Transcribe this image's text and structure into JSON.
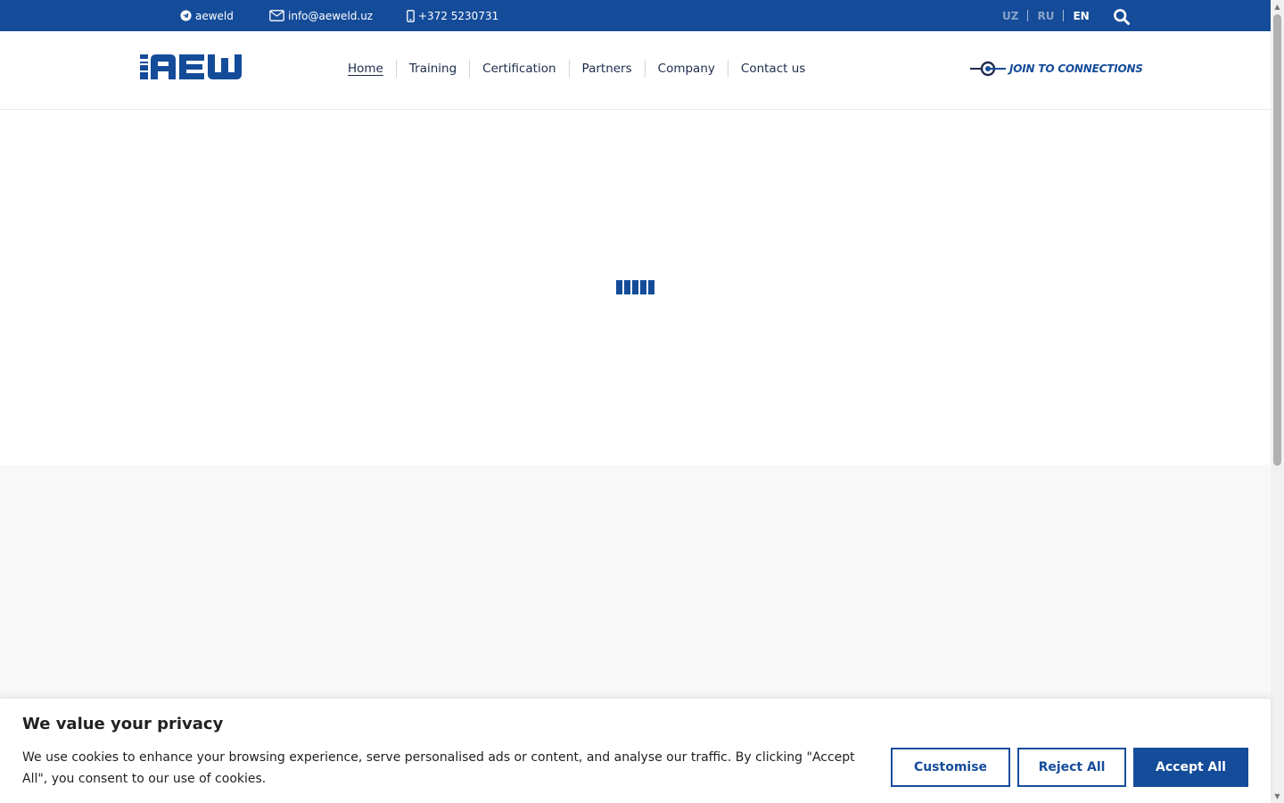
{
  "topbar": {
    "telegram_label": "aeweld",
    "email": "info@aeweld.uz",
    "phone": "+372 5230731",
    "languages": [
      "UZ",
      "RU",
      "EN"
    ],
    "active_language": "EN"
  },
  "header": {
    "logo_text": "IAEW",
    "nav": [
      "Home",
      "Training",
      "Certification",
      "Partners",
      "Company",
      "Contact us"
    ],
    "active_nav": "Home",
    "join_label": "JOIN TO CONNECTIONS"
  },
  "cookie": {
    "title": "We value your privacy",
    "text": "We use cookies to enhance your browsing experience, serve personalised ads or content, and analyse our traffic. By clicking \"Accept All\", you consent to our use of cookies.",
    "customise": "Customise",
    "reject": "Reject All",
    "accept": "Accept All"
  },
  "colors": {
    "brand": "#154c9a",
    "section_bg": "#f8f8f8"
  },
  "icons": [
    "telegram-icon",
    "mail-icon",
    "phone-icon",
    "search-icon",
    "connection-plug-icon",
    "loading-bars-icon"
  ]
}
